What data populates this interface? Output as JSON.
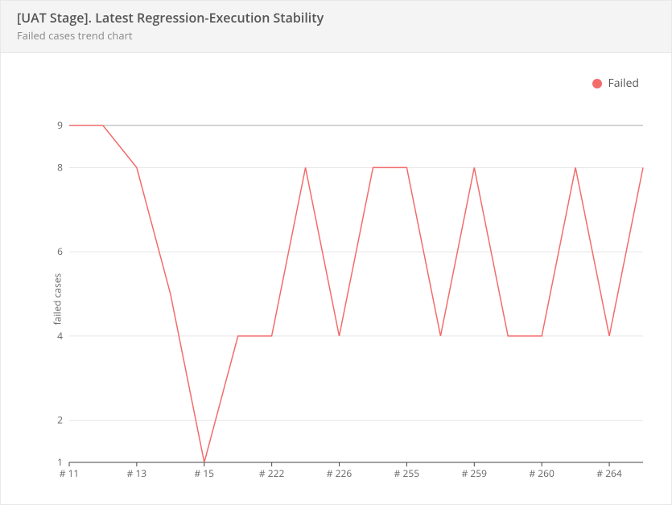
{
  "header": {
    "title": "[UAT Stage]. Latest Regression-Execution Stability",
    "subtitle": "Failed cases trend chart"
  },
  "legend": {
    "failed": "Failed"
  },
  "axis": {
    "ylabel": "failed cases"
  },
  "chart_data": {
    "type": "line",
    "title": "[UAT Stage]. Latest Regression-Execution Stability",
    "xlabel": "",
    "ylabel": "failed cases",
    "ylim": [
      1,
      9
    ],
    "y_ticks": [
      1,
      2,
      4,
      6,
      8,
      9
    ],
    "x_tick_labels": [
      "# 11",
      "# 13",
      "# 15",
      "# 222",
      "# 226",
      "# 255",
      "# 259",
      "# 260",
      "# 264"
    ],
    "x_tick_indices": [
      0,
      2,
      4,
      6,
      8,
      10,
      12,
      14,
      16
    ],
    "series": [
      {
        "name": "Failed",
        "color": "#f36c6c",
        "values": [
          9,
          9,
          8,
          5,
          1,
          4,
          4,
          8,
          4,
          8,
          8,
          4,
          8,
          4,
          4,
          8,
          4,
          8
        ]
      }
    ],
    "legend_position": "top-right",
    "grid": true
  }
}
